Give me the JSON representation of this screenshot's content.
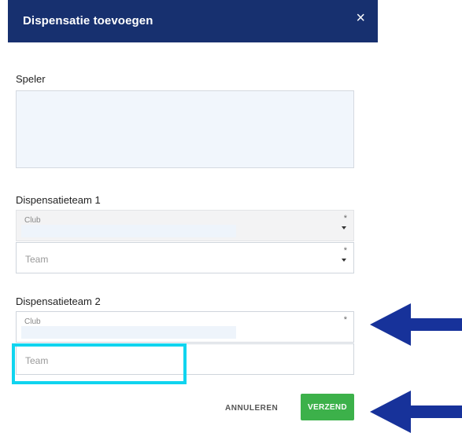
{
  "dialog": {
    "title": "Dispensatie toevoegen",
    "close_glyph": "×"
  },
  "player": {
    "label": "Speler"
  },
  "team1": {
    "label": "Dispensatieteam 1",
    "club": {
      "label": "Club",
      "required": "*"
    },
    "team": {
      "placeholder": "Team",
      "required": "*"
    }
  },
  "team2": {
    "label": "Dispensatieteam 2",
    "club": {
      "label": "Club",
      "required": "*"
    },
    "team": {
      "placeholder": "Team"
    }
  },
  "actions": {
    "cancel_label": "ANNULEREN",
    "submit_label": "VERZEND"
  },
  "colors": {
    "header_bg": "#17306f",
    "submit_bg": "#3cb14a",
    "highlight": "#10d4ef",
    "arrow": "#17329a"
  },
  "icons": {
    "close": "close-icon",
    "dropdown": "chevron-down-icon"
  }
}
